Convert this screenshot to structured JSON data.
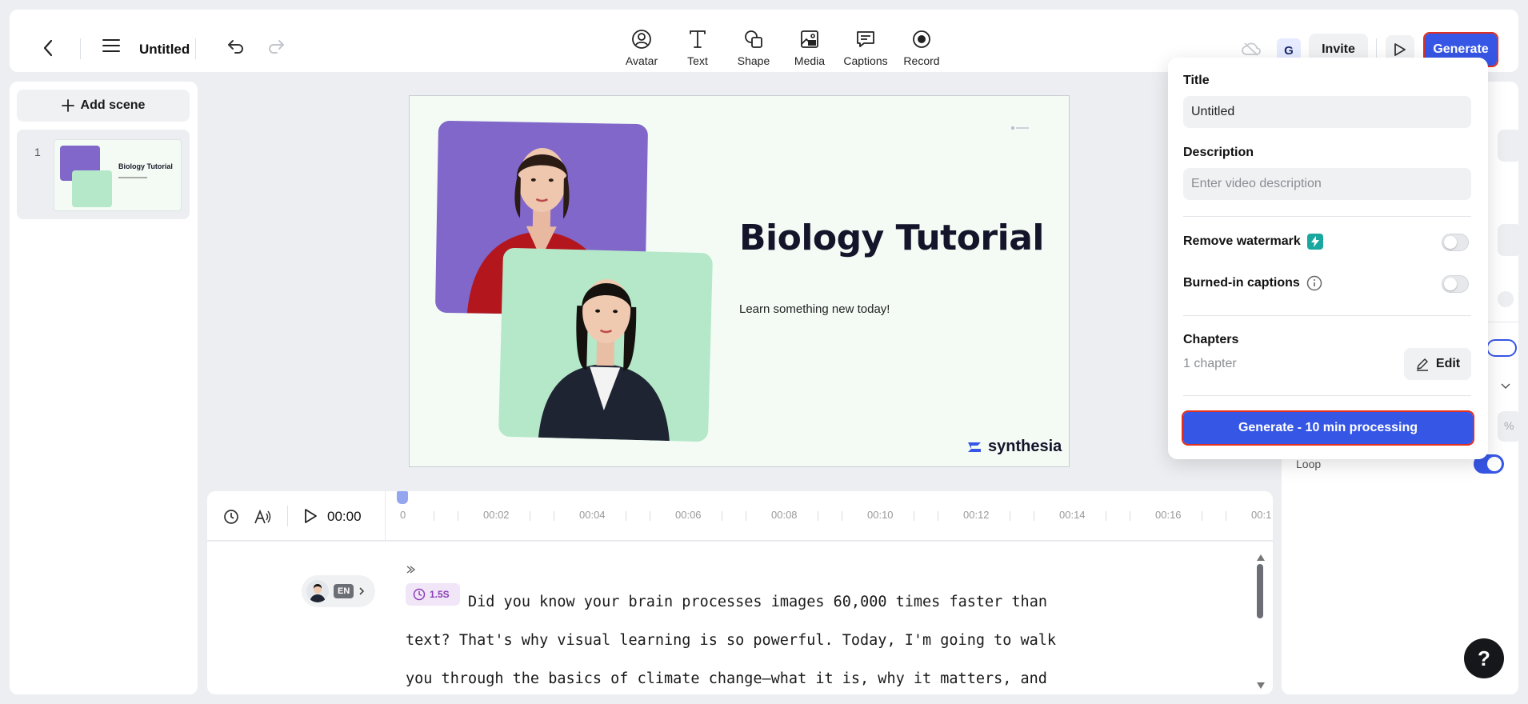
{
  "header": {
    "doc_title": "Untitled",
    "tools": [
      {
        "label": "Avatar",
        "icon": "avatar-icon"
      },
      {
        "label": "Text",
        "icon": "text-icon"
      },
      {
        "label": "Shape",
        "icon": "shape-icon"
      },
      {
        "label": "Media",
        "icon": "media-icon"
      },
      {
        "label": "Captions",
        "icon": "captions-icon"
      },
      {
        "label": "Record",
        "icon": "record-icon"
      }
    ],
    "user_initial": "G",
    "invite_label": "Invite",
    "generate_label": "Generate"
  },
  "scenes": {
    "add_label": "Add scene",
    "items": [
      {
        "number": "1",
        "thumb_title": "Biology Tutorial"
      }
    ]
  },
  "slide": {
    "title": "Biology Tutorial",
    "subtitle": "Learn something new today!",
    "logo_text": "synthesia"
  },
  "timeline": {
    "current_time": "00:00",
    "ticks": [
      "0",
      "00:02",
      "00:04",
      "00:06",
      "00:08",
      "00:10",
      "00:12",
      "00:14",
      "00:16",
      "00:1"
    ]
  },
  "script": {
    "language": "EN",
    "pause_label": "1.5S",
    "text": "Did you know your brain processes images 60,000 times faster than text? That's why visual learning is so powerful. Today, I'm going to walk you through the basics of climate change—what it is, why it matters, and"
  },
  "right_panel": {
    "loop_label": "Loop",
    "partial_suffix": "%"
  },
  "generate_popover": {
    "title_label": "Title",
    "title_value": "Untitled",
    "description_label": "Description",
    "description_placeholder": "Enter video description",
    "remove_watermark_label": "Remove watermark",
    "burned_captions_label": "Burned-in captions",
    "chapters_label": "Chapters",
    "chapters_count": "1 chapter",
    "edit_label": "Edit",
    "generate_processing_label": "Generate - 10 min processing"
  },
  "help_label": "?",
  "colors": {
    "accent": "#3656e6",
    "avatar_bg_purple": "#8067c9",
    "avatar_bg_green": "#b4e8c9",
    "slide_bg": "#f3fbf4"
  }
}
